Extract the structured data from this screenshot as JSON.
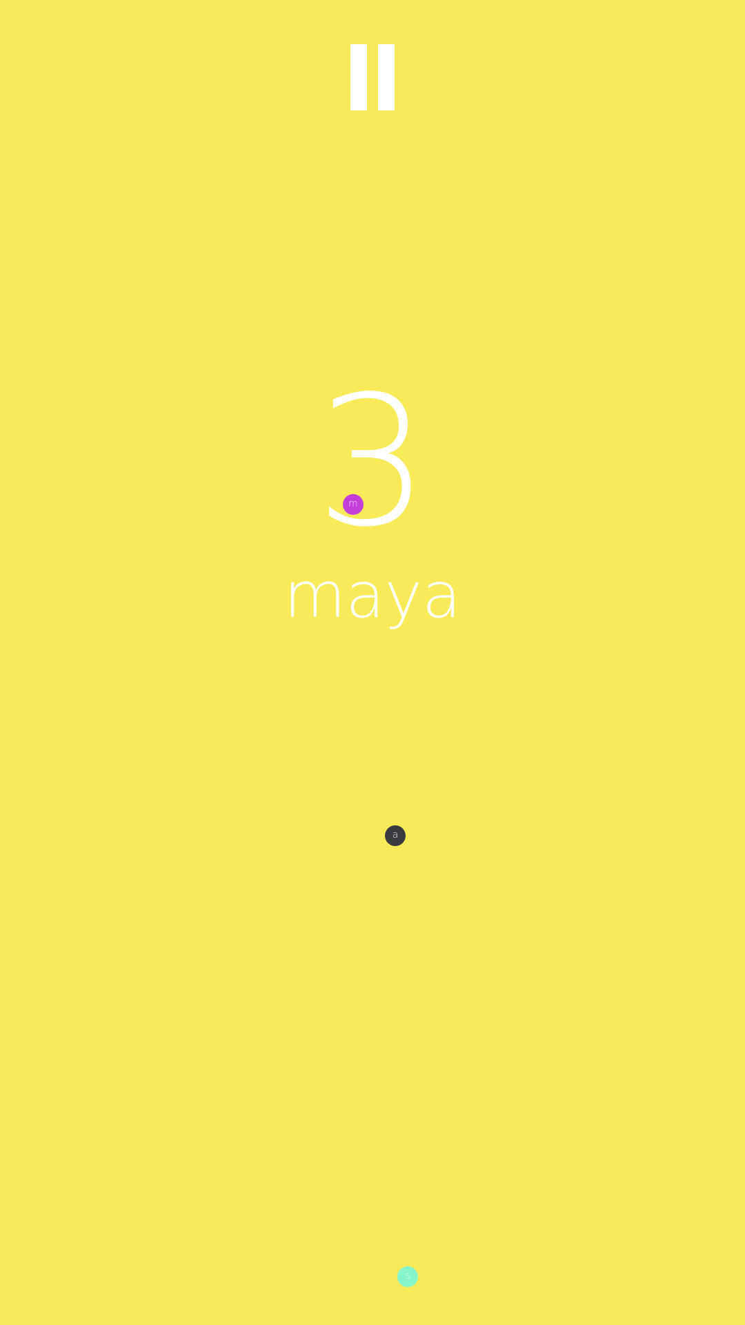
{
  "game": {
    "score": "3",
    "player_name": "maya"
  },
  "controls": {
    "pause_icon": "pause-icon"
  },
  "balls": [
    {
      "letter": "m",
      "color": "#C33FDA",
      "text_color": "#F4D9F5"
    },
    {
      "letter": "a",
      "color": "#3A3B40",
      "text_color": "#E8E8E8"
    },
    {
      "letter": "s",
      "color": "#86F5CB",
      "text_color": "#E6FFF6"
    }
  ],
  "theme": {
    "background": "#F8EA58",
    "foreground": "#FFFFFF"
  }
}
